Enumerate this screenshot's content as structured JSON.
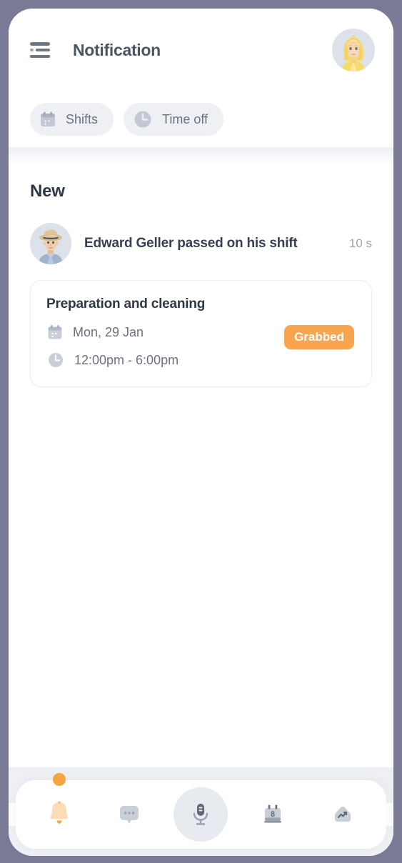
{
  "window": {
    "frame_color": "#7b7a96",
    "screen_background": "#ffffff"
  },
  "header": {
    "menu_icon": "hamburger-menu-icon",
    "title": "Notification",
    "avatar": "user-avatar-blonde-woman"
  },
  "filters": {
    "chips": [
      {
        "label": "Shifts",
        "icon": "calendar-icon",
        "active": false
      },
      {
        "label": "Time off",
        "icon": "clock-icon",
        "active": false
      }
    ]
  },
  "content": {
    "section_title": "New",
    "notification": {
      "avatar": "avatar-man-straw-hat",
      "message": "Edward Geller passed on his shift",
      "time": "10 s"
    },
    "shift_card": {
      "title": "Preparation and cleaning",
      "date_icon": "calendar-icon",
      "date": "Mon, 29 Jan",
      "time_icon": "clock-icon",
      "time_range": "12:00pm - 6:00pm",
      "status": "Grabbed",
      "status_color": "#f9a44f"
    }
  },
  "bottom_nav": {
    "items": [
      {
        "name": "notifications",
        "icon": "bell-icon",
        "active": true,
        "badge": true
      },
      {
        "name": "messages",
        "icon": "chat-bubble-icon",
        "active": false,
        "badge": false
      },
      {
        "name": "voice",
        "icon": "microphone-icon",
        "active": false,
        "badge": false
      },
      {
        "name": "schedule",
        "icon": "calendar-icon",
        "badge_number": "8",
        "active": false,
        "badge": false
      },
      {
        "name": "reports",
        "icon": "trending-up-icon",
        "active": false,
        "badge": false
      }
    ],
    "accent_color": "#f9a340"
  }
}
